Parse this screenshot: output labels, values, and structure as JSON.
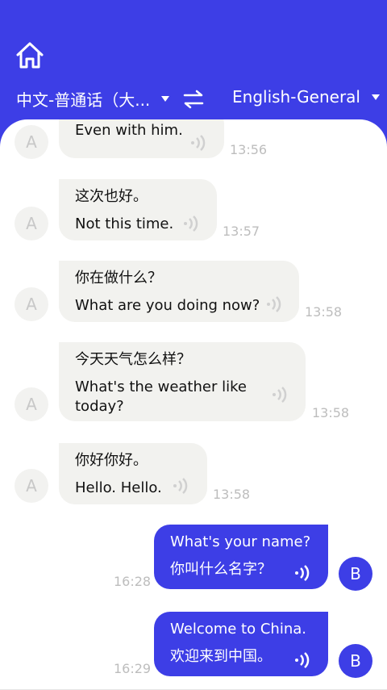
{
  "header": {
    "source_language": "中文-普通话（大...",
    "target_language": "English-General"
  },
  "messages": [
    {
      "speaker": "A",
      "original": "",
      "translation": "Even with him.",
      "time": "13:56"
    },
    {
      "speaker": "A",
      "original": "这次也好。",
      "translation": "Not this time.",
      "time": "13:57"
    },
    {
      "speaker": "A",
      "original": "你在做什么？",
      "translation": "What are you doing now?",
      "time": "13:58"
    },
    {
      "speaker": "A",
      "original": "今天天气怎么样？",
      "translation": "What's the weather like",
      "translation_cont": "today?",
      "time": "13:58"
    },
    {
      "speaker": "A",
      "original": "你好你好。",
      "translation": "Hello. Hello.",
      "time": "13:58"
    },
    {
      "speaker": "B",
      "original": "What's your name?",
      "translation": "你叫什么名字？",
      "time": "16:28"
    },
    {
      "speaker": "B",
      "original": "Welcome to China.",
      "translation": "欢迎来到中国。",
      "time": "16:29"
    }
  ],
  "colors": {
    "accent": "#3d3ee6",
    "bubble_left": "#f2f2ef"
  },
  "icons": {
    "home": "home-icon",
    "swap": "swap-icon",
    "speaker": "speaker-icon"
  }
}
